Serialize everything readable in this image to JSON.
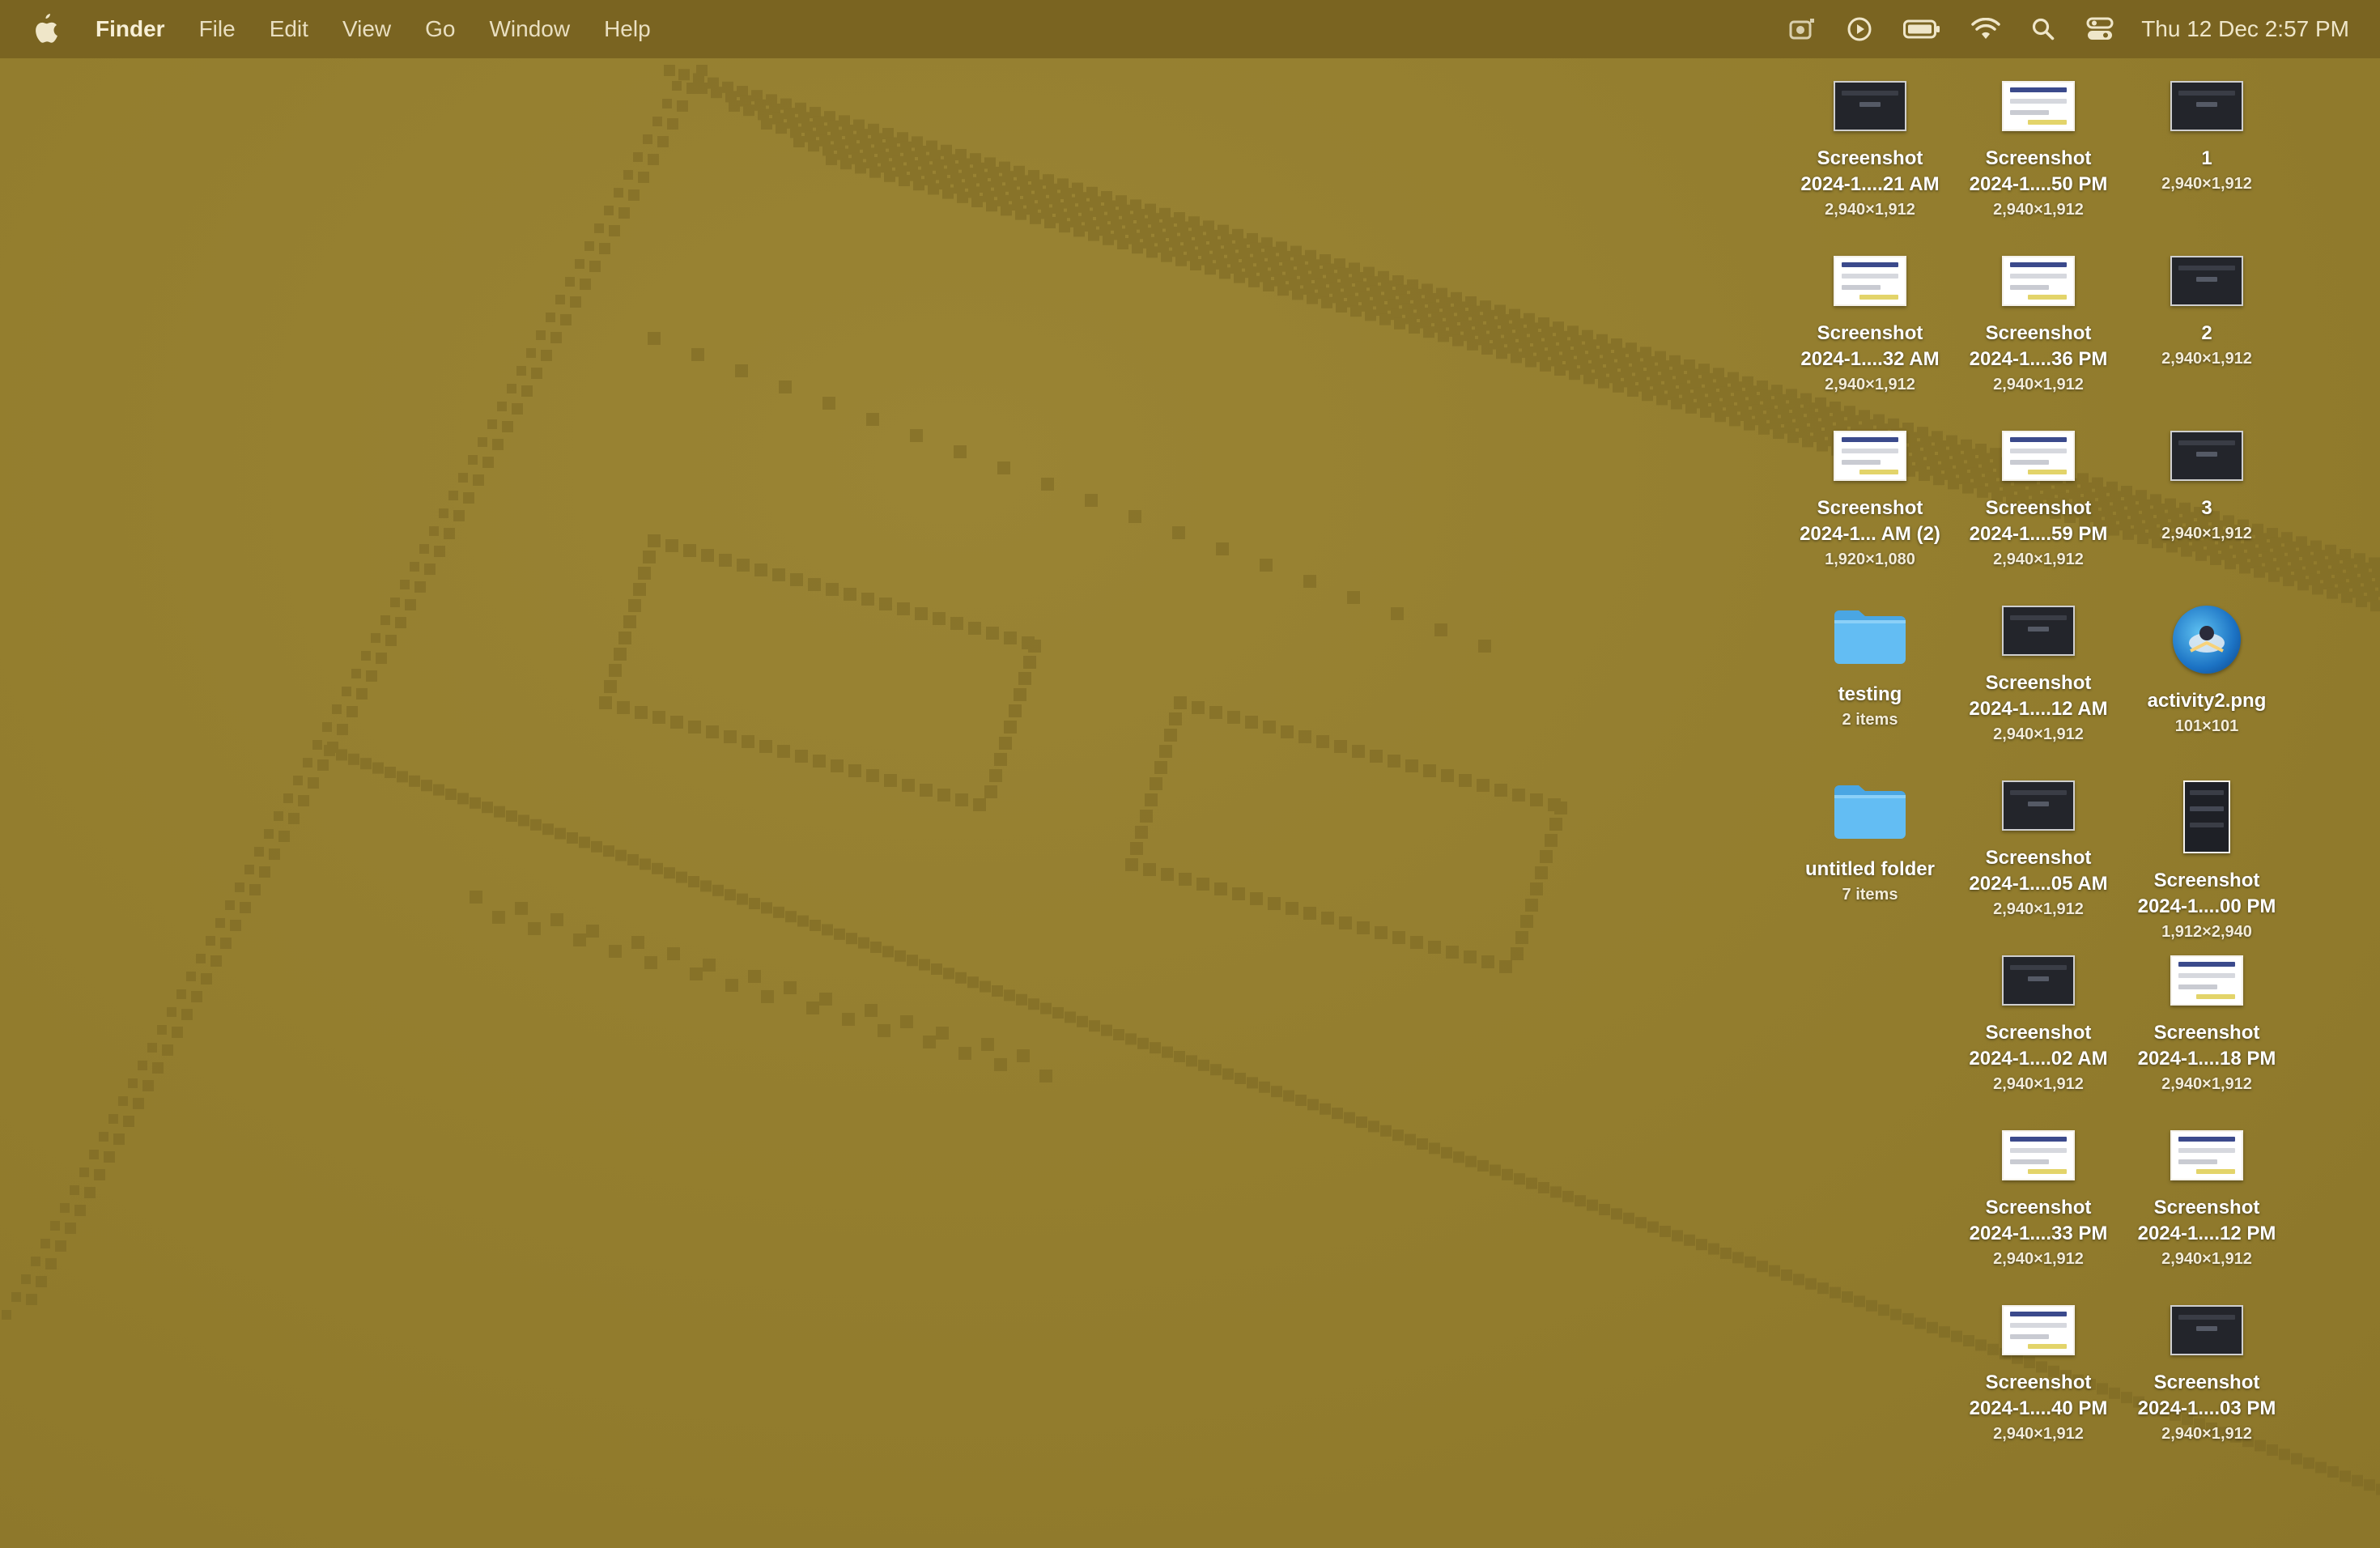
{
  "menubar": {
    "app_name": "Finder",
    "menus": [
      "File",
      "Edit",
      "View",
      "Go",
      "Window",
      "Help"
    ],
    "clock": "Thu 12 Dec  2:57 PM",
    "status_icons": [
      "lunar-icon",
      "play-circle-icon",
      "battery-icon",
      "wifi-icon",
      "search-icon",
      "control-center-icon"
    ]
  },
  "desktop": {
    "items": [
      {
        "name": "Screenshot",
        "sub": "2024-1....21 AM",
        "meta": "2,940×1,912",
        "kind": "screenshot",
        "thumb": "dark"
      },
      {
        "name": "Screenshot",
        "sub": "2024-1....50 PM",
        "meta": "2,940×1,912",
        "kind": "screenshot",
        "thumb": "light"
      },
      {
        "name": "1",
        "sub": "",
        "meta": "2,940×1,912",
        "kind": "screenshot",
        "thumb": "dark"
      },
      {
        "name": "Screenshot",
        "sub": "2024-1....32 AM",
        "meta": "2,940×1,912",
        "kind": "screenshot",
        "thumb": "light"
      },
      {
        "name": "Screenshot",
        "sub": "2024-1....36 PM",
        "meta": "2,940×1,912",
        "kind": "screenshot",
        "thumb": "light"
      },
      {
        "name": "2",
        "sub": "",
        "meta": "2,940×1,912",
        "kind": "screenshot",
        "thumb": "dark"
      },
      {
        "name": "Screenshot",
        "sub": "2024-1... AM (2)",
        "meta": "1,920×1,080",
        "kind": "screenshot",
        "thumb": "light"
      },
      {
        "name": "Screenshot",
        "sub": "2024-1....59 PM",
        "meta": "2,940×1,912",
        "kind": "screenshot",
        "thumb": "light"
      },
      {
        "name": "3",
        "sub": "",
        "meta": "2,940×1,912",
        "kind": "screenshot",
        "thumb": "dark"
      },
      {
        "name": "testing",
        "sub": "",
        "meta": "2 items",
        "kind": "folder"
      },
      {
        "name": "Screenshot",
        "sub": "2024-1....12 AM",
        "meta": "2,940×1,912",
        "kind": "screenshot",
        "thumb": "dark"
      },
      {
        "name": "activity2.png",
        "sub": "",
        "meta": "101×101",
        "kind": "image"
      },
      {
        "name": "untitled folder",
        "sub": "",
        "meta": "7 items",
        "kind": "folder"
      },
      {
        "name": "Screenshot",
        "sub": "2024-1....05 AM",
        "meta": "2,940×1,912",
        "kind": "screenshot",
        "thumb": "dark"
      },
      {
        "name": "Screenshot",
        "sub": "2024-1....00 PM",
        "meta": "1,912×2,940",
        "kind": "screenshot",
        "thumb": "tall"
      },
      {
        "name": "Screenshot",
        "sub": "2024-1....02 AM",
        "meta": "2,940×1,912",
        "kind": "screenshot",
        "thumb": "dark"
      },
      {
        "name": "Screenshot",
        "sub": "2024-1....18 PM",
        "meta": "2,940×1,912",
        "kind": "screenshot",
        "thumb": "light"
      },
      {
        "name": "Screenshot",
        "sub": "2024-1....33 PM",
        "meta": "2,940×1,912",
        "kind": "screenshot",
        "thumb": "light"
      },
      {
        "name": "Screenshot",
        "sub": "2024-1....12 PM",
        "meta": "2,940×1,912",
        "kind": "screenshot",
        "thumb": "light"
      },
      {
        "name": "Screenshot",
        "sub": "2024-1....40 PM",
        "meta": "2,940×1,912",
        "kind": "screenshot",
        "thumb": "light"
      },
      {
        "name": "Screenshot",
        "sub": "2024-1....03 PM",
        "meta": "2,940×1,912",
        "kind": "screenshot",
        "thumb": "dark"
      }
    ]
  },
  "colors": {
    "desktop": "#957f2f",
    "menubar": "#7a6421",
    "folder": "#5bb6f0"
  }
}
